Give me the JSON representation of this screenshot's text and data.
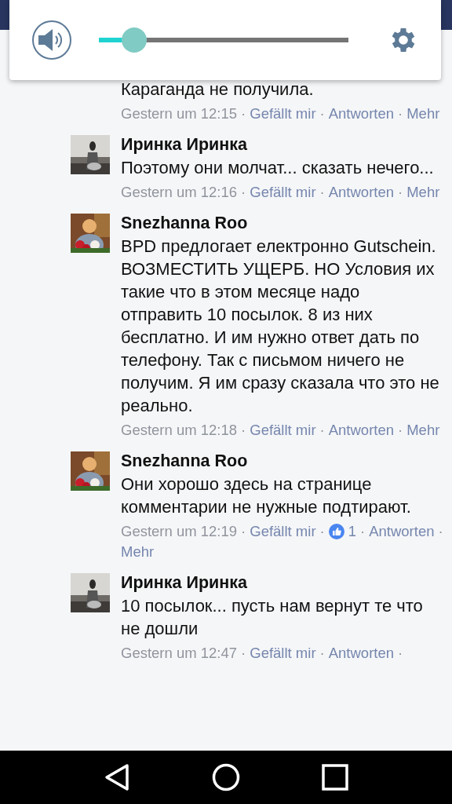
{
  "volume_panel": {
    "level": 0.14
  },
  "comments": [
    {
      "kind": "continued",
      "body": "Караганда не получила.",
      "meta": [
        {
          "kind": "time",
          "text": "Gestern um 12:15"
        },
        {
          "kind": "sep",
          "text": "·"
        },
        {
          "kind": "link",
          "text": "Gefällt mir"
        },
        {
          "kind": "sep",
          "text": "·"
        },
        {
          "kind": "link",
          "text": "Antworten"
        },
        {
          "kind": "sep",
          "text": "·"
        },
        {
          "kind": "link",
          "text": "Mehr"
        }
      ]
    },
    {
      "kind": "full",
      "avatar": {
        "kind": "picture"
      },
      "author": "Иринка Иринка",
      "body": "Поэтому они молчат... сказать нечего...",
      "meta": [
        {
          "kind": "time",
          "text": "Gestern um 12:16"
        },
        {
          "kind": "sep",
          "text": "·"
        },
        {
          "kind": "link",
          "text": "Gefällt mir"
        },
        {
          "kind": "sep",
          "text": "·"
        },
        {
          "kind": "link",
          "text": "Antworten"
        },
        {
          "kind": "sep",
          "text": "·"
        },
        {
          "kind": "link",
          "text": "Mehr"
        }
      ]
    },
    {
      "kind": "full",
      "avatar": {
        "kind": "picture"
      },
      "author": "Snezhanna Roo",
      "body": "BPD предлогает електронно Gutschein. ВОЗМЕСТИТЬ УЩЕРБ. НО Условия их такие что в этом месяце надо отправить 10 посылок. 8 из них бесплатно. И им нужно ответ дать по телефону. Так с письмом ничего не получим. Я им сразу сказала что это не реально.",
      "meta": [
        {
          "kind": "time",
          "text": "Gestern um 12:18"
        },
        {
          "kind": "sep",
          "text": "·"
        },
        {
          "kind": "link",
          "text": "Gefällt mir"
        },
        {
          "kind": "sep",
          "text": "·"
        },
        {
          "kind": "link",
          "text": "Antworten"
        },
        {
          "kind": "sep",
          "text": "·"
        },
        {
          "kind": "link",
          "text": "Mehr"
        }
      ]
    },
    {
      "kind": "full",
      "avatar": {
        "kind": "picture"
      },
      "author": "Snezhanna Roo",
      "body": "Они хорошо здесь на странице комментарии не нужные подтирают.",
      "meta": [
        {
          "kind": "time",
          "text": "Gestern um 12:19"
        },
        {
          "kind": "sep",
          "text": "·"
        },
        {
          "kind": "link",
          "text": "Gefällt mir"
        },
        {
          "kind": "sep",
          "text": "·"
        },
        {
          "kind": "likes",
          "text": "1"
        },
        {
          "kind": "sep",
          "text": "·"
        },
        {
          "kind": "link",
          "text": "Antworten"
        },
        {
          "kind": "sep",
          "text": "·"
        },
        {
          "kind": "link",
          "text": "Mehr"
        }
      ]
    },
    {
      "kind": "full",
      "avatar": {
        "kind": "picture"
      },
      "author": "Иринка Иринка",
      "body": "10 посылок... пусть нам вернут те что не дошли",
      "meta": [
        {
          "kind": "time",
          "text": "Gestern um 12:47"
        },
        {
          "kind": "sep",
          "text": "·"
        },
        {
          "kind": "link",
          "text": "Gefällt mir"
        },
        {
          "kind": "sep",
          "text": "·"
        },
        {
          "kind": "link",
          "text": "Antworten"
        },
        {
          "kind": "sep",
          "text": "·"
        }
      ]
    }
  ]
}
